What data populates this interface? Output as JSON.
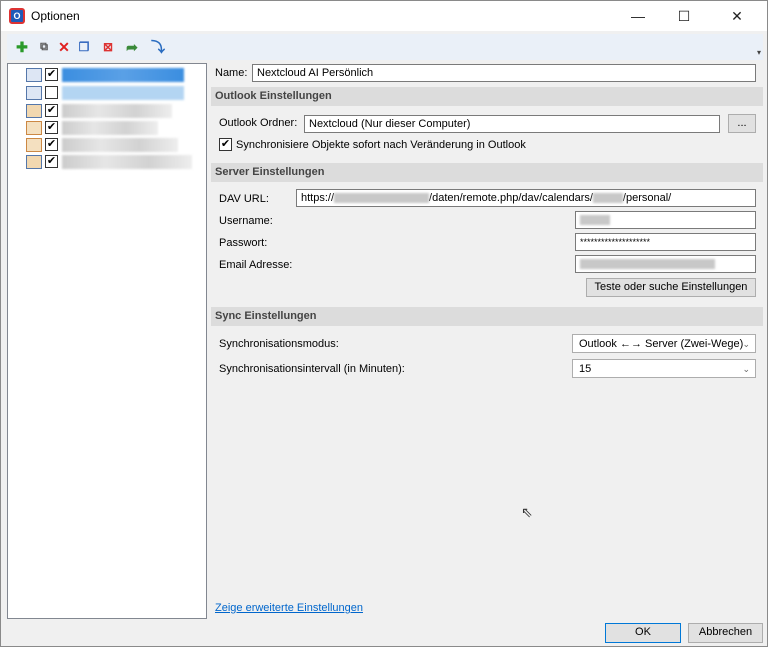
{
  "window": {
    "title": "Optionen",
    "app_icon": "outlook-caldav-icon",
    "minimize": "—",
    "maximize": "☐",
    "close": "✕"
  },
  "toolbar": {
    "icons": [
      "add-icon",
      "add-multiple-icon",
      "delete-icon",
      "copy-icon",
      "clear-cache-icon",
      "export-icon",
      "import-icon"
    ]
  },
  "tree": {
    "items": [
      {
        "icon": "calendar-icon",
        "checked": true,
        "selected": true
      },
      {
        "icon": "calendar-icon",
        "checked": false
      },
      {
        "icon": "contacts-icon",
        "checked": true
      },
      {
        "icon": "tasks-icon",
        "checked": true
      },
      {
        "icon": "tasks-icon",
        "checked": true
      },
      {
        "icon": "contacts-icon",
        "checked": true
      }
    ]
  },
  "form": {
    "name_label": "Name:",
    "name_value": "Nextcloud AI Persönlich",
    "outlook_header": "Outlook Einstellungen",
    "outlook_folder_label": "Outlook Ordner:",
    "outlook_folder_value": "Nextcloud (Nur dieser Computer)",
    "browse_button": "...",
    "sync_immediately_label": "Synchronisiere Objekte sofort nach Veränderung in Outlook",
    "sync_immediately_checked": true,
    "server_header": "Server Einstellungen",
    "dav_url_label": "DAV URL:",
    "dav_url_prefix": "https://",
    "dav_url_mid": "/daten/remote.php/dav/calendars/",
    "dav_url_suffix": "/personal/",
    "username_label": "Username:",
    "password_label": "Passwort:",
    "password_value": "********************",
    "email_label": "Email Adresse:",
    "test_button": "Teste oder suche Einstellungen",
    "sync_header": "Sync Einstellungen",
    "sync_mode_label": "Synchronisationsmodus:",
    "sync_mode_value": "Outlook ←→ Server (Zwei-Wege)",
    "sync_interval_label": "Synchronisationsintervall (in Minuten):",
    "sync_interval_value": "15",
    "advanced_link": "Zeige erweiterte Einstellungen"
  },
  "footer": {
    "ok": "OK",
    "cancel": "Abbrechen"
  }
}
